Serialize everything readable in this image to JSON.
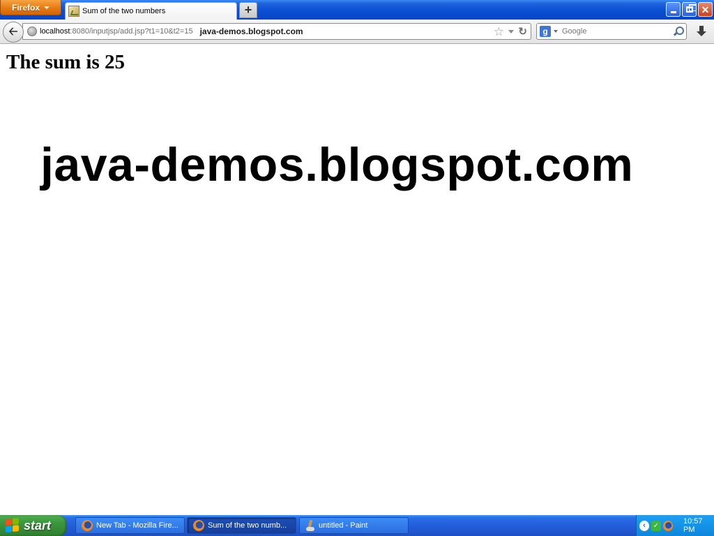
{
  "browser": {
    "menu_button_label": "Firefox",
    "tab_title": "Sum of the two numbers",
    "new_tab_label": "+",
    "url_host": "localhost",
    "url_path": ":8080/inputjsp/add.jsp?t1=10&t2=15",
    "url_site_label": "java-demos.blogspot.com",
    "search_engine": "Google",
    "search_placeholder": "Google"
  },
  "page": {
    "heading": "The sum is 25",
    "watermark": "java-demos.blogspot.com"
  },
  "taskbar": {
    "start_label": "start",
    "items": [
      {
        "label": "New Tab - Mozilla Fire...",
        "icon": "firefox-icon",
        "active": false
      },
      {
        "label": "Sum of the two numb...",
        "icon": "firefox-icon",
        "active": true
      },
      {
        "label": "untitled - Paint",
        "icon": "paint-icon",
        "active": false
      }
    ],
    "clock": "10:57 PM"
  }
}
